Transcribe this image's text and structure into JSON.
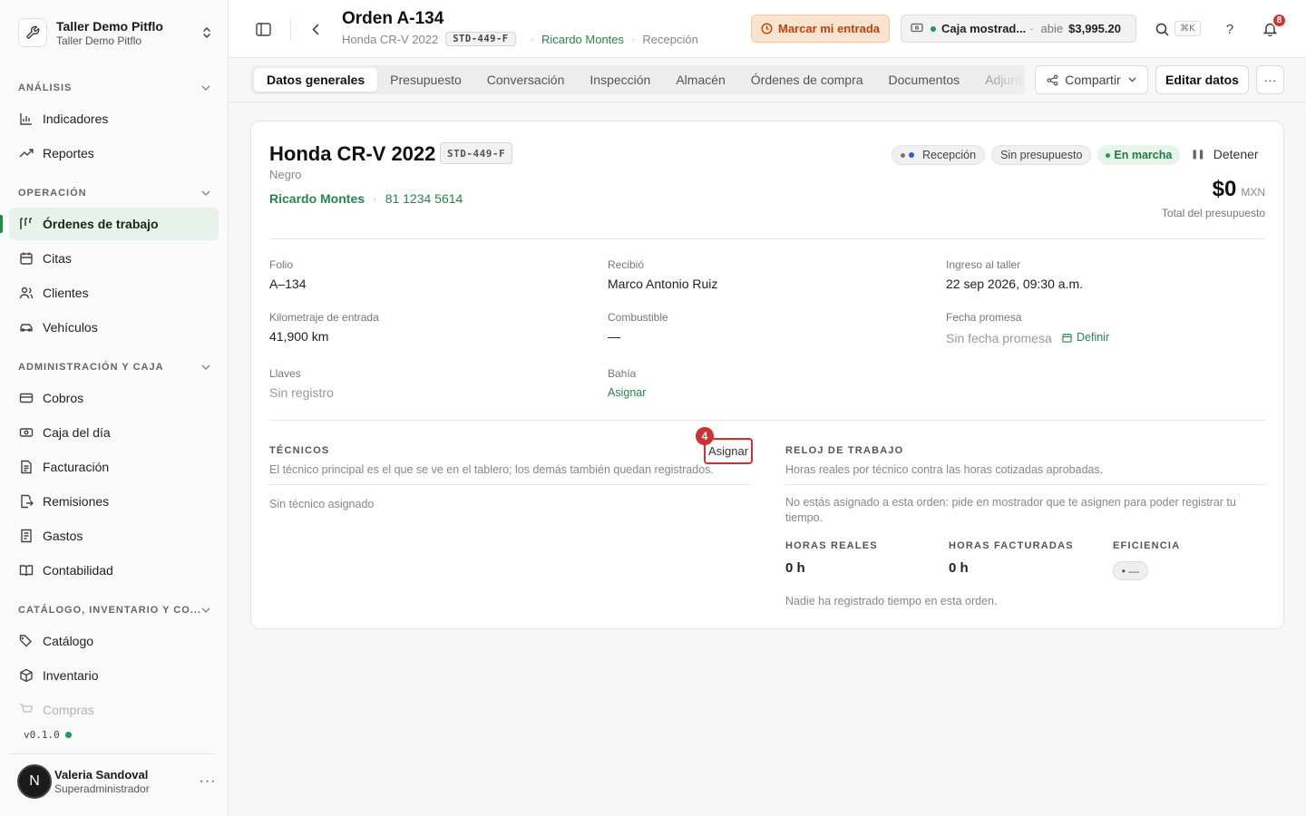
{
  "workspace": {
    "name": "Taller Demo Pitflo",
    "subtitle": "Taller Demo Pitflo"
  },
  "sidebar": {
    "sections": [
      {
        "label": "ANÁLISIS",
        "items": [
          {
            "label": "Indicadores",
            "icon": "bar-chart-icon"
          },
          {
            "label": "Reportes",
            "icon": "trending-up-icon"
          }
        ]
      },
      {
        "label": "OPERACIÓN",
        "items": [
          {
            "label": "Órdenes de trabajo",
            "icon": "kanban-icon",
            "active": true
          },
          {
            "label": "Citas",
            "icon": "calendar-icon"
          },
          {
            "label": "Clientes",
            "icon": "users-icon"
          },
          {
            "label": "Vehículos",
            "icon": "car-icon"
          }
        ]
      },
      {
        "label": "ADMINISTRACIÓN Y CAJA",
        "items": [
          {
            "label": "Cobros",
            "icon": "credit-card-icon"
          },
          {
            "label": "Caja del día",
            "icon": "cash-icon"
          },
          {
            "label": "Facturación",
            "icon": "file-text-icon"
          },
          {
            "label": "Remisiones",
            "icon": "file-export-icon"
          },
          {
            "label": "Gastos",
            "icon": "receipt-icon"
          },
          {
            "label": "Contabilidad",
            "icon": "book-icon"
          }
        ]
      },
      {
        "label": "CATÁLOGO, INVENTARIO Y CO...",
        "items": [
          {
            "label": "Catálogo",
            "icon": "tags-icon"
          },
          {
            "label": "Inventario",
            "icon": "package-icon"
          },
          {
            "label": "Compras",
            "icon": "cart-icon"
          }
        ]
      }
    ],
    "version": "v0.1.0",
    "user": {
      "initial": "N",
      "name": "Valeria Sandoval",
      "role": "Superadministrador",
      "more": "···"
    }
  },
  "header": {
    "title": "Orden A-134",
    "vehicle": "Honda CR-V 2022",
    "plate": "STD-449-F",
    "customer": "Ricardo Montes",
    "stage": "Recepción",
    "entry_button": "Marcar mi entrada",
    "cash": {
      "name": "Caja mostrad...",
      "status": "abie",
      "amount": "$3,995.20"
    },
    "shortcut": "⌘K",
    "help": "?",
    "notifications": "8"
  },
  "tabs": [
    {
      "label": "Datos generales",
      "active": true
    },
    {
      "label": "Presupuesto"
    },
    {
      "label": "Conversación"
    },
    {
      "label": "Inspección"
    },
    {
      "label": "Almacén"
    },
    {
      "label": "Órdenes de compra"
    },
    {
      "label": "Documentos"
    },
    {
      "label": "Adjuntos"
    }
  ],
  "actions": {
    "share": "Compartir",
    "edit": "Editar datos",
    "more": "···"
  },
  "card": {
    "title": "Honda CR-V 2022",
    "plate": "STD-449-F",
    "color": "Negro",
    "owner": "Ricardo Montes",
    "phone": "81 1234 5614",
    "pills": {
      "stage": "Recepción",
      "budget": "Sin presupuesto",
      "running": "En marcha"
    },
    "stop": "Detener",
    "amount": "$0",
    "currency": "MXN",
    "amount_label": "Total del presupuesto",
    "fields": {
      "folio": {
        "label": "Folio",
        "value": "A–134"
      },
      "received": {
        "label": "Recibió",
        "value": "Marco Antonio Ruiz"
      },
      "entry": {
        "label": "Ingreso al taller",
        "value": "22 sep 2026, 09:30 a.m."
      },
      "km": {
        "label": "Kilometraje de entrada",
        "value": "41,900 km"
      },
      "fuel": {
        "label": "Combustible",
        "value": "—"
      },
      "promise": {
        "label": "Fecha promesa",
        "value": "Sin fecha promesa",
        "action": "Definir"
      },
      "keys": {
        "label": "Llaves",
        "value": "Sin registro"
      },
      "bay": {
        "label": "Bahía",
        "action": "Asignar"
      }
    },
    "technicians": {
      "heading": "TÉCNICOS",
      "description": "El técnico principal es el que se ve en el tablero; los demás también quedan registrados.",
      "assign": "Asignar",
      "step": "4",
      "empty": "Sin técnico asignado"
    },
    "clock": {
      "heading": "RELOJ DE TRABAJO",
      "description": "Horas reales por técnico contra las horas cotizadas aprobadas.",
      "notice": "No estás asignado a esta orden: pide en mostrador que te asignen para poder registrar tu tiempo.",
      "real_label": "HORAS REALES",
      "real_value": "0 h",
      "billed_label": "HORAS FACTURADAS",
      "billed_value": "0 h",
      "eff_label": "EFICIENCIA",
      "eff_value": "• —",
      "footer": "Nadie ha registrado tiempo en esta orden."
    }
  },
  "colors": {
    "accent": "#1f8a4c",
    "danger": "#d32f2f",
    "warning": "#c2410c"
  }
}
